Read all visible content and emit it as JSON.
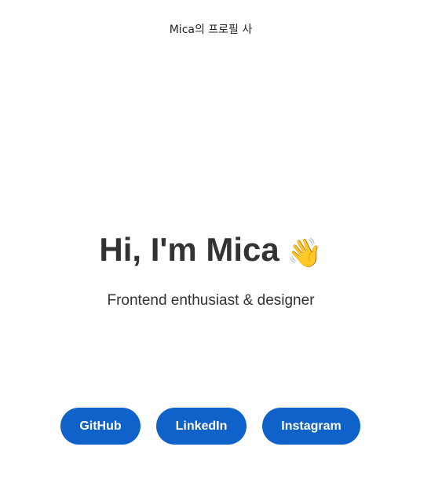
{
  "page": {
    "caption": "Mica의 프로필 사"
  },
  "hero": {
    "title": "Hi, I'm Mica",
    "wave_emoji": "👋",
    "subtitle": "Frontend enthusiast & designer"
  },
  "links": [
    {
      "label": "GitHub"
    },
    {
      "label": "LinkedIn"
    },
    {
      "label": "Instagram"
    }
  ],
  "colors": {
    "button_bg": "#0f62c9",
    "text": "#333333"
  }
}
